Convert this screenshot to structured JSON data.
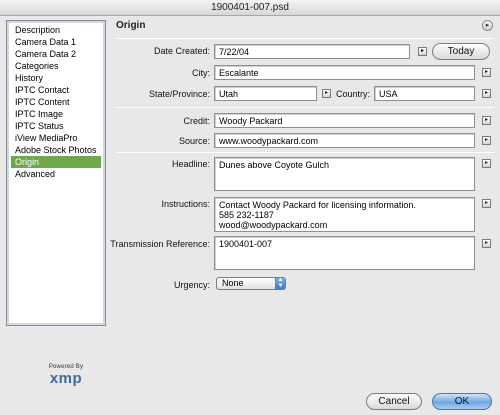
{
  "window": {
    "title": "1900401-007.psd"
  },
  "sidebar": {
    "items": [
      {
        "label": "Description"
      },
      {
        "label": "Camera Data 1"
      },
      {
        "label": "Camera Data 2"
      },
      {
        "label": "Categories"
      },
      {
        "label": "History"
      },
      {
        "label": "IPTC Contact"
      },
      {
        "label": "IPTC Content"
      },
      {
        "label": "IPTC Image"
      },
      {
        "label": "IPTC Status"
      },
      {
        "label": "iView MediaPro"
      },
      {
        "label": "Adobe Stock Photos"
      },
      {
        "label": "Origin"
      },
      {
        "label": "Advanced"
      }
    ],
    "active": "Origin"
  },
  "branding": {
    "powered": "Powered By",
    "mark": "xmp"
  },
  "panel": {
    "title": "Origin",
    "date_created": {
      "label": "Date Created:",
      "value": "7/22/04",
      "today_label": "Today"
    },
    "city": {
      "label": "City:",
      "value": "Escalante"
    },
    "state": {
      "label": "State/Province:",
      "value": "Utah"
    },
    "country": {
      "label": "Country:",
      "value": "USA"
    },
    "credit": {
      "label": "Credit:",
      "value": "Woody Packard"
    },
    "source": {
      "label": "Source:",
      "value": "www.woodypackard.com"
    },
    "headline": {
      "label": "Headline:",
      "value": "Dunes above Coyote Gulch"
    },
    "instructions": {
      "label": "Instructions:",
      "value": "Contact Woody Packard for licensing information.\n585 232-1187\nwood@woodypackard.com"
    },
    "transmission": {
      "label": "Transmission Reference:",
      "value": "1900401-007"
    },
    "urgency": {
      "label": "Urgency:",
      "value": "None"
    }
  },
  "buttons": {
    "cancel": "Cancel",
    "ok": "OK"
  },
  "colors": {
    "active_item": "#6ea84a",
    "default_button": "#6fa6e0"
  }
}
